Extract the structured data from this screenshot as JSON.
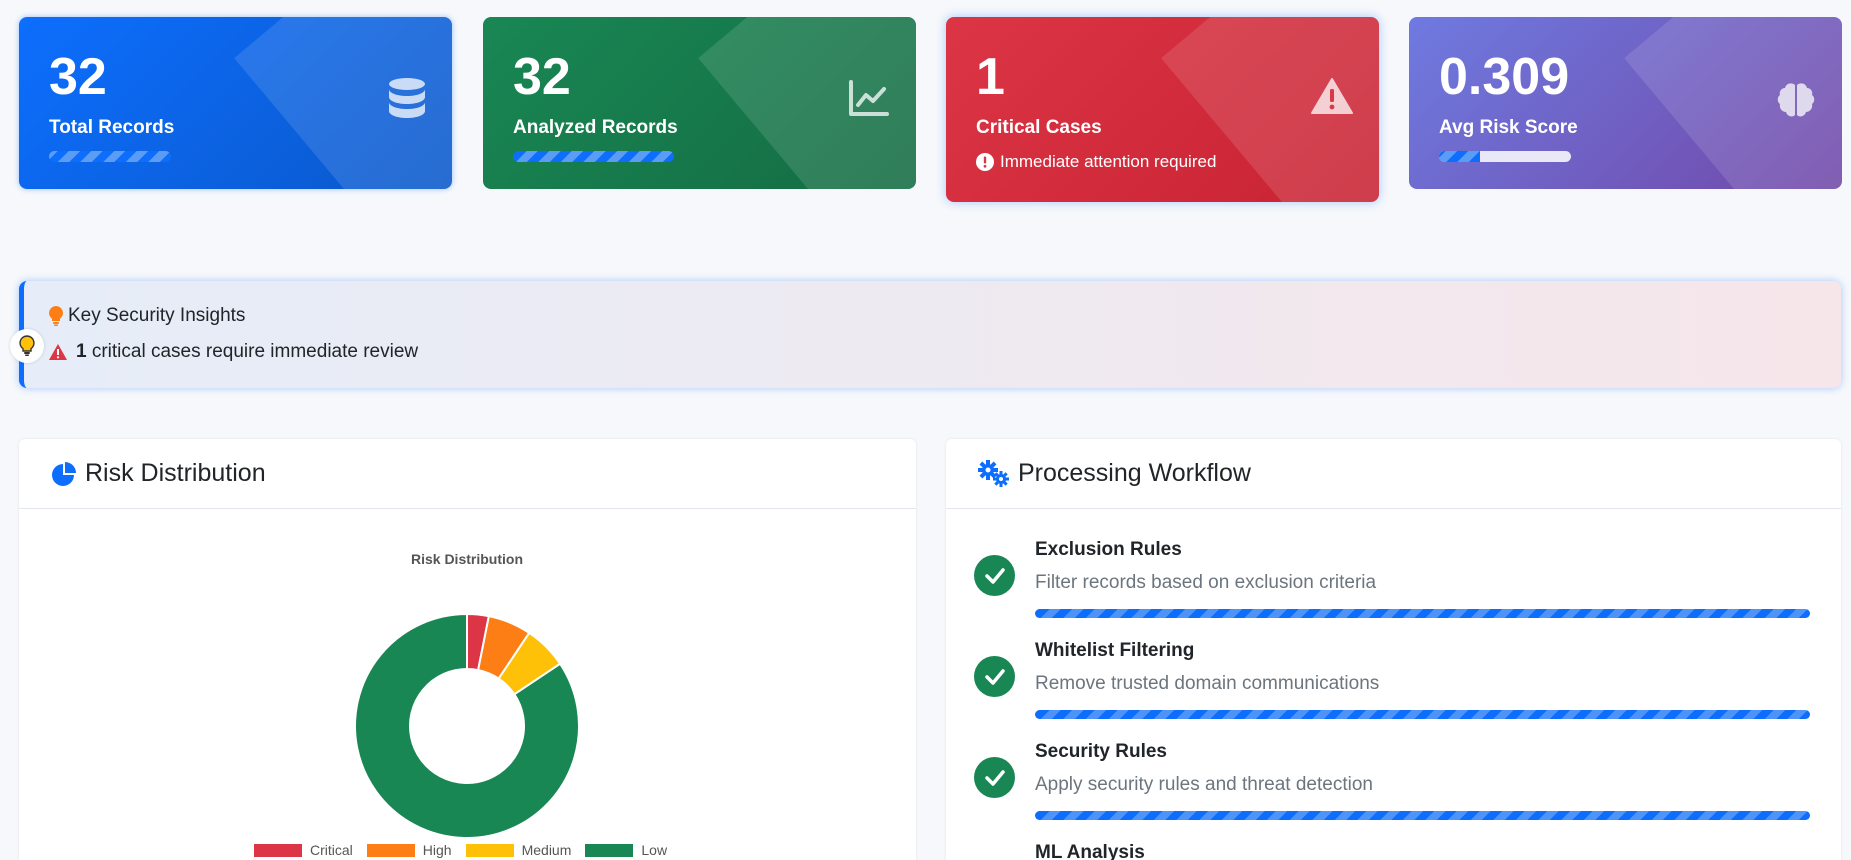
{
  "stats": [
    {
      "value": "32",
      "label": "Total Records",
      "icon": "database-icon",
      "progress": 1.0
    },
    {
      "value": "32",
      "label": "Analyzed Records",
      "icon": "chart-line-icon",
      "progress": 1.0
    },
    {
      "value": "1",
      "label": "Critical Cases",
      "icon": "warning-icon",
      "note": "Immediate attention required"
    },
    {
      "value": "0.309",
      "label": "Avg Risk Score",
      "icon": "brain-icon",
      "progress": 0.309
    }
  ],
  "insights": {
    "title": "Key Security Insights",
    "count": "1",
    "text": "critical cases require immediate review"
  },
  "risk_panel": {
    "title": "Risk Distribution"
  },
  "workflow_panel": {
    "title": "Processing Workflow",
    "steps": [
      {
        "name": "Exclusion Rules",
        "desc": "Filter records based on exclusion criteria",
        "status": "complete"
      },
      {
        "name": "Whitelist Filtering",
        "desc": "Remove trusted domain communications",
        "status": "complete"
      },
      {
        "name": "Security Rules",
        "desc": "Apply security rules and threat detection",
        "status": "complete"
      },
      {
        "name": "ML Analysis",
        "desc": "",
        "status": "complete"
      }
    ]
  },
  "chart_data": {
    "type": "pie",
    "title": "Risk Distribution",
    "categories": [
      "Critical",
      "High",
      "Medium",
      "Low"
    ],
    "values": [
      1,
      2,
      2,
      27
    ],
    "colors": [
      "#dc3545",
      "#fd7e14",
      "#ffc107",
      "#198754"
    ],
    "donut": true,
    "legend": "bottom"
  }
}
